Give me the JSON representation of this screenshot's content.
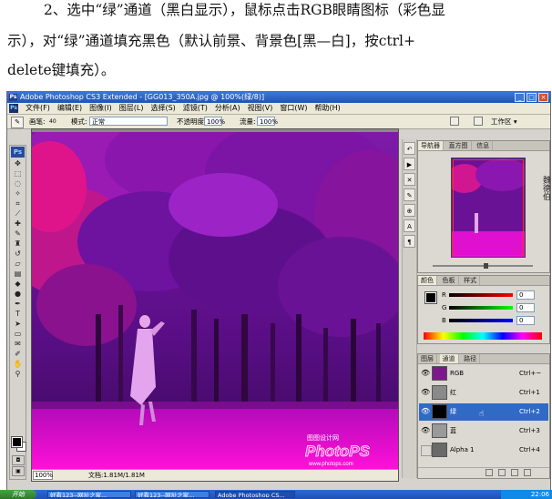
{
  "instructions": {
    "line1": "2、选中“绿”通道（黑白显示），鼠标点击RGB眼睛图标（彩色显",
    "line2": "示），对“绿”通道填充黑色（默认前景、背景色[黑—白]，按ctrl+",
    "line3": "delete键填充）。"
  },
  "app": {
    "title": "Adobe Photoshop CS3 Extended - [GG013_350A.jpg @ 100%(绿/8)]",
    "logo": "Ps"
  },
  "menu": [
    "文件(F)",
    "编辑(E)",
    "图像(I)",
    "图层(L)",
    "选择(S)",
    "滤镜(T)",
    "分析(A)",
    "视图(V)",
    "窗口(W)",
    "帮助(H)"
  ],
  "options": {
    "brush_label": "画笔:",
    "brush_size": "40",
    "mode_label": "模式:",
    "mode_value": "正常",
    "opacity_label": "不透明度:",
    "opacity_value": "100%",
    "flow_label": "流量:",
    "flow_value": "100%",
    "workspace": "工作区 ▾"
  },
  "document": {
    "zoom": "100%",
    "info": "文档:1.81M/1.81M",
    "watermark_title": "图图设计网",
    "watermark_brand": "PhotoPS",
    "watermark_url": "www.photops.com"
  },
  "navigator": {
    "tabs": [
      "导航器",
      "直方图",
      "信息"
    ],
    "signature": "魏德伯"
  },
  "color_panel": {
    "tabs": [
      "颜色",
      "色板",
      "样式"
    ],
    "sliders": [
      {
        "label": "R",
        "value": "0",
        "color": "#e02020"
      },
      {
        "label": "G",
        "value": "0",
        "color": "#20a020"
      },
      {
        "label": "B",
        "value": "0",
        "color": "#2040d0"
      }
    ]
  },
  "channels_panel": {
    "tabs": [
      "图层",
      "通道",
      "路径"
    ],
    "channels": [
      {
        "name": "RGB",
        "shortcut": "Ctrl+~",
        "thumb": "#7a1a8a",
        "selected": false,
        "eye": true
      },
      {
        "name": "红",
        "shortcut": "Ctrl+1",
        "thumb": "#8a8a8a",
        "selected": false,
        "eye": true
      },
      {
        "name": "绿",
        "shortcut": "Ctrl+2",
        "thumb": "#000000",
        "selected": true,
        "eye": true
      },
      {
        "name": "蓝",
        "shortcut": "Ctrl+3",
        "thumb": "#9a9a9a",
        "selected": false,
        "eye": true
      },
      {
        "name": "Alpha 1",
        "shortcut": "Ctrl+4",
        "thumb": "#6a6a6a",
        "selected": false,
        "eye": false
      }
    ]
  },
  "taskbar": {
    "start": "开始",
    "buttons": [
      "好看123--网址之家...",
      "好看123--网址之家...",
      "Adobe Photoshop CS..."
    ],
    "clock": "22:06"
  }
}
